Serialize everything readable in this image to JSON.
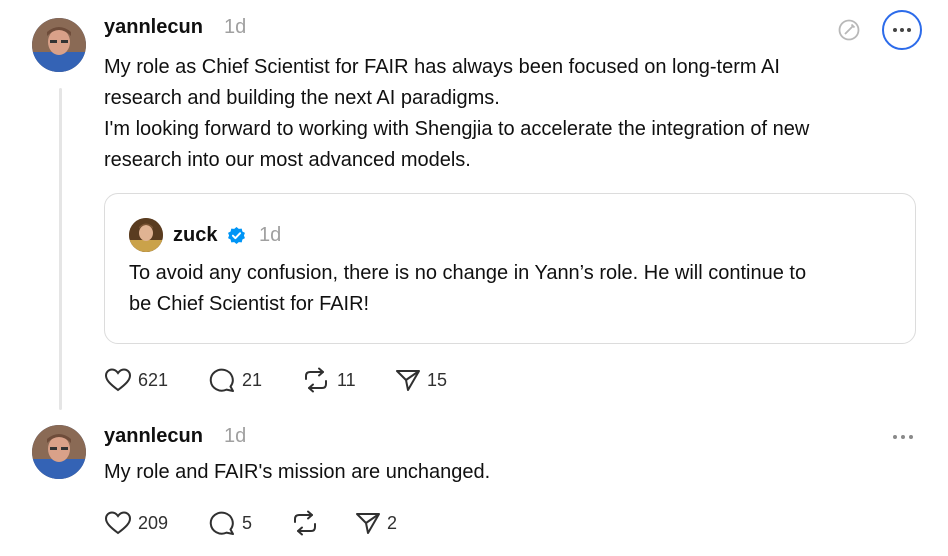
{
  "posts": [
    {
      "username": "yannlecun",
      "time": "1d",
      "text_lines": [
        "My role as Chief Scientist for FAIR has always been focused on long-term AI",
        "research and building the next AI paradigms.",
        "I'm looking forward to working with Shengjia to accelerate the integration of new",
        "research into our most advanced models."
      ],
      "quote": {
        "username": "zuck",
        "verified": true,
        "time": "1d",
        "text_lines": [
          "To avoid any confusion, there is no change in Yann’s role. He will continue to",
          "be Chief Scientist for FAIR!"
        ]
      },
      "actions": {
        "likes": "621",
        "replies": "21",
        "reposts": "11",
        "shares": "15"
      }
    },
    {
      "username": "yannlecun",
      "time": "1d",
      "text_lines": [
        "My role and FAIR's mission are unchanged."
      ],
      "actions": {
        "likes": "209",
        "replies": "5",
        "reposts": "",
        "shares": "2"
      }
    }
  ],
  "colors": {
    "accent": "#2c6bea",
    "verified": "#0095f6",
    "muted": "#a0a0a0"
  },
  "icons": [
    "like-icon",
    "reply-icon",
    "repost-icon",
    "share-icon",
    "more-icon",
    "edit-disabled-icon",
    "verified-badge-icon"
  ]
}
